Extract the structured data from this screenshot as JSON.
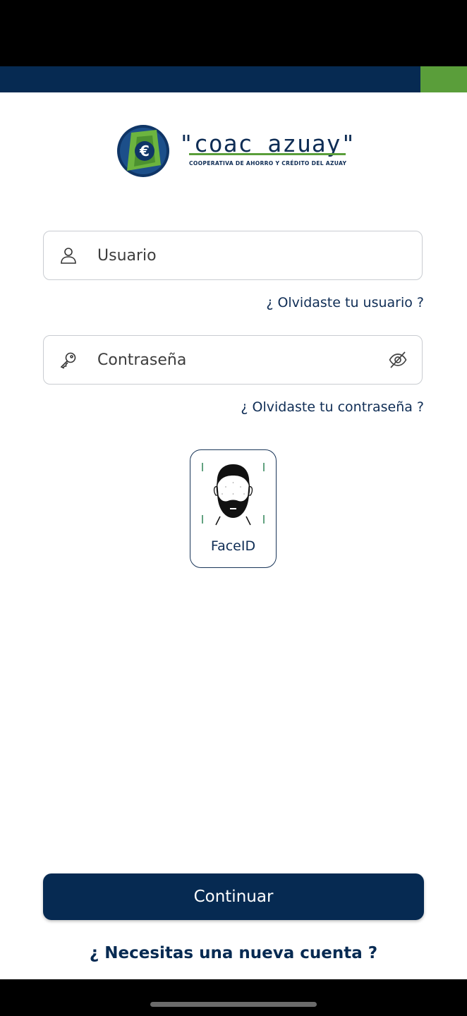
{
  "brand": {
    "name": "\"coac azuay\"",
    "tagline": "COOPERATIVA DE AHORRO Y CRÉDITO DEL AZUAY",
    "primary_color": "#062a52",
    "accent_color": "#5a9e3a"
  },
  "login": {
    "username": {
      "placeholder": "Usuario",
      "value": "",
      "icon": "user-icon"
    },
    "forgot_username": "¿ Olvidaste tu usuario ?",
    "password": {
      "placeholder": "Contraseña",
      "value": "",
      "icon": "key-icon",
      "toggle_icon": "eye-off-icon"
    },
    "forgot_password": "¿ Olvidaste tu contraseña ?",
    "faceid_label": "FaceID",
    "continue_label": "Continuar",
    "new_account": "¿ Necesitas una nueva cuenta ?"
  }
}
